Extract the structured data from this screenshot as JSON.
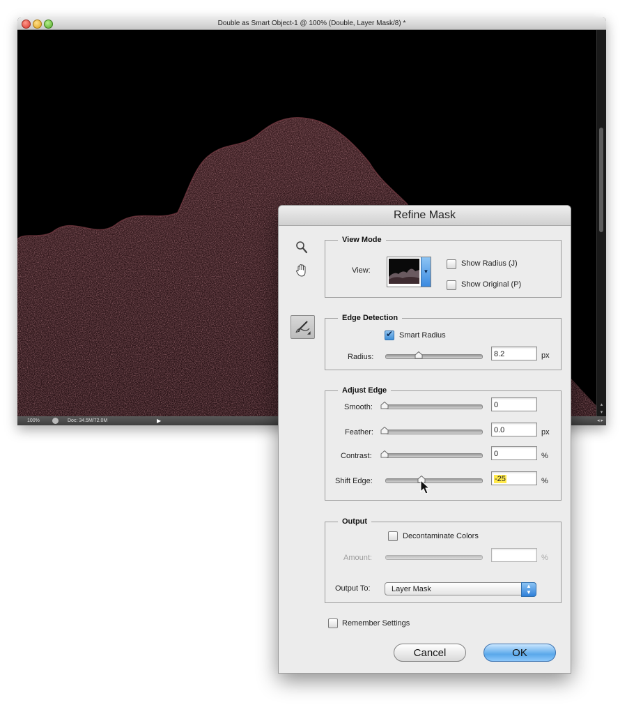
{
  "document_window": {
    "title": "Double as Smart Object-1 @ 100% (Double, Layer Mask/8) *",
    "status": {
      "zoom": "100%",
      "doc_size": "Doc: 34.5M/72.0M"
    }
  },
  "dialog": {
    "title": "Refine Mask",
    "view_mode": {
      "legend": "View Mode",
      "view_label": "View:",
      "show_radius": {
        "label": "Show Radius (J)",
        "checked": false
      },
      "show_original": {
        "label": "Show Original (P)",
        "checked": false
      }
    },
    "edge_detection": {
      "legend": "Edge Detection",
      "smart_radius": {
        "label": "Smart Radius",
        "checked": true
      },
      "radius_label": "Radius:",
      "radius_value": "8.2",
      "radius_unit": "px"
    },
    "adjust_edge": {
      "legend": "Adjust Edge",
      "smooth_label": "Smooth:",
      "smooth_value": "0",
      "feather_label": "Feather:",
      "feather_value": "0.0",
      "feather_unit": "px",
      "contrast_label": "Contrast:",
      "contrast_value": "0",
      "contrast_unit": "%",
      "shift_edge_label": "Shift Edge:",
      "shift_edge_value": "-25",
      "shift_edge_unit": "%"
    },
    "output": {
      "legend": "Output",
      "decontaminate": {
        "label": "Decontaminate Colors",
        "checked": false
      },
      "amount_label": "Amount:",
      "amount_value": "",
      "amount_unit": "%",
      "output_to_label": "Output To:",
      "output_to_value": "Layer Mask"
    },
    "remember_settings": {
      "label": "Remember Settings",
      "checked": false
    },
    "buttons": {
      "cancel": "Cancel",
      "ok": "OK"
    }
  }
}
